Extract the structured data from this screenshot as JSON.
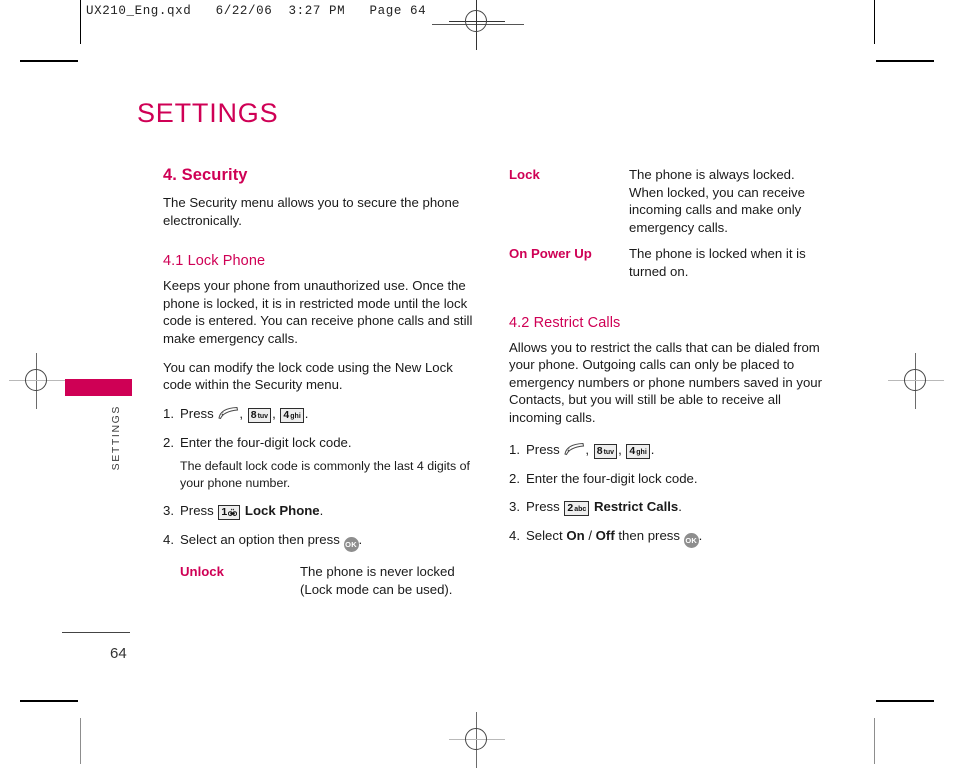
{
  "proof": {
    "header": "UX210_Eng.qxd   6/22/06  3:27 PM   Page 64"
  },
  "side_tab": {
    "label": "SETTINGS",
    "color": "#cf0055"
  },
  "page": {
    "title": "SETTINGS",
    "number": "64",
    "accent_color": "#cf0055"
  },
  "security": {
    "heading": "4. Security",
    "intro": "The Security menu allows you to secure the phone electronically.",
    "lock_phone": {
      "heading": "4.1 Lock Phone",
      "para1": "Keeps your phone from unauthorized use. Once the phone is locked, it is in restricted mode until the lock code is entered. You can receive phone calls and still make emergency calls.",
      "para2": "You can modify the lock code using the New Lock code within the Security menu.",
      "step1": {
        "num": "1.",
        "label": "Press",
        "end": "."
      },
      "step2": {
        "num": "2.",
        "text": "Enter the four-digit lock code."
      },
      "step2_note": "The default lock code is commonly the last 4 digits of your phone number.",
      "step3": {
        "num": "3.",
        "label": "Press",
        "bold": "Lock Phone",
        "end": "."
      },
      "step4": {
        "num": "4.",
        "label": "Select an option then press",
        "end": "."
      },
      "options": [
        {
          "term": "Unlock",
          "desc": "The phone is never locked (Lock mode can be used)."
        },
        {
          "term": "Lock",
          "desc": "The phone is always locked. When locked, you can receive incoming calls and make only emergency calls."
        },
        {
          "term": "On Power Up",
          "desc": "The phone is locked when it is turned on."
        }
      ]
    },
    "restrict_calls": {
      "heading": "4.2 Restrict Calls",
      "para1": "Allows you to restrict the calls that can be dialed from your phone. Outgoing calls can only be placed to emergency numbers or phone numbers saved in your Contacts, but you will still be able to receive all incoming calls.",
      "step1": {
        "num": "1.",
        "label": "Press",
        "end": "."
      },
      "step2": {
        "num": "2.",
        "text": "Enter the four-digit lock code."
      },
      "step3": {
        "num": "3.",
        "label": "Press",
        "bold": "Restrict Calls",
        "end": "."
      },
      "step4": {
        "num": "4.",
        "label": "Select",
        "bold_a": "On",
        "sep": "/",
        "bold_b": "Off",
        "label2": "then press",
        "end": "."
      }
    }
  },
  "keys": {
    "send": {
      "name": "send-call-key-icon"
    },
    "k8": {
      "digit": "8",
      "letters": "tuv"
    },
    "k4": {
      "digit": "4",
      "letters": "ghi"
    },
    "k2": {
      "digit": "2",
      "letters": "abc"
    },
    "k1": {
      "digit": "1",
      "letters": ""
    },
    "ok": {
      "label": "OK"
    }
  }
}
